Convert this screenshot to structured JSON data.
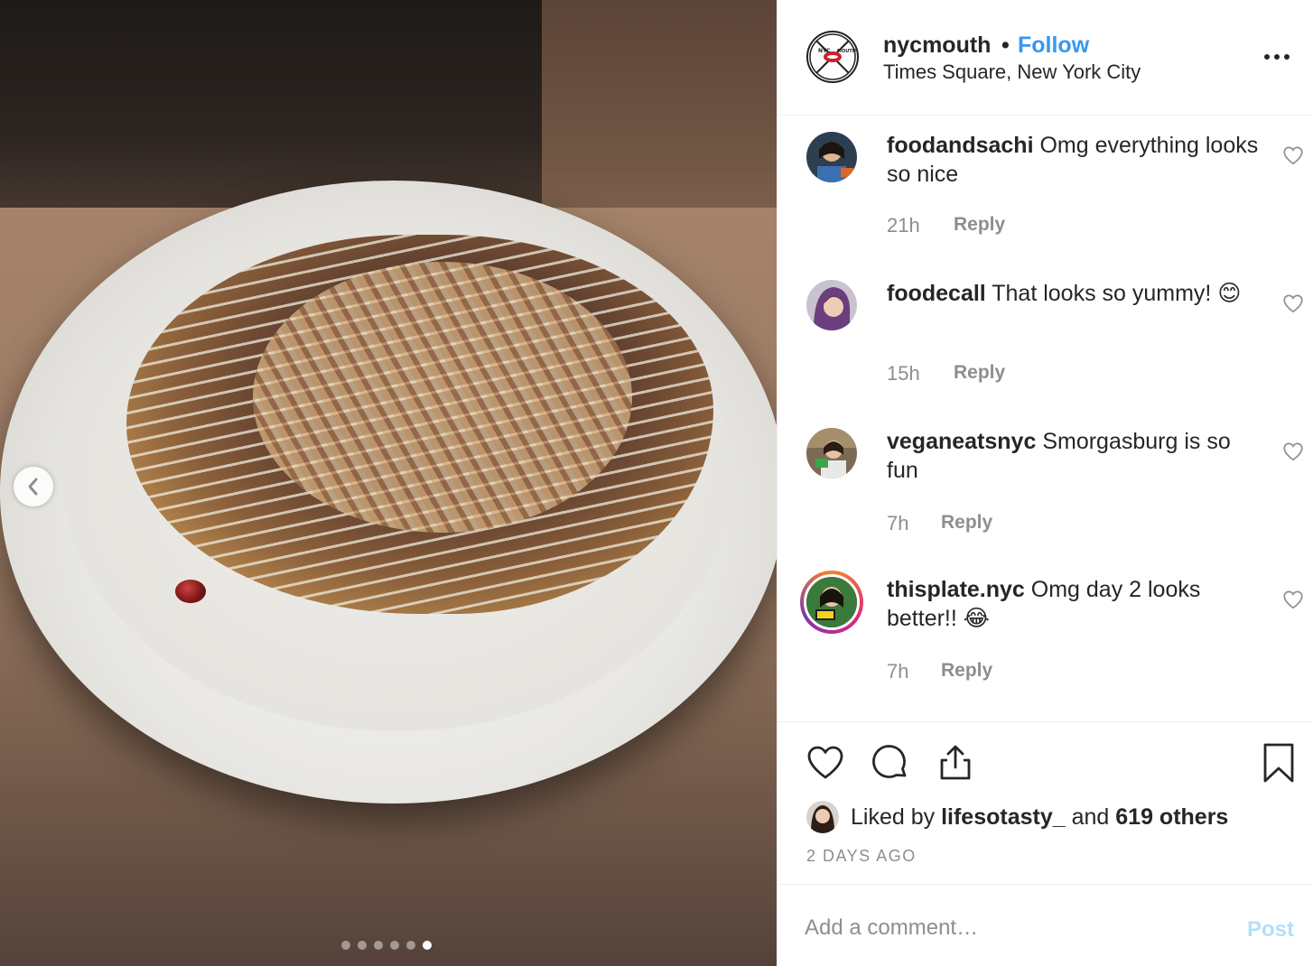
{
  "post": {
    "author": "nycmouth",
    "separator": "•",
    "follow_label": "Follow",
    "location": "Times Square, New York City",
    "logo_text": "NYC MOUTH"
  },
  "carousel": {
    "slide_count": 6,
    "active_index": 5
  },
  "comments": [
    {
      "user": "foodandsachi",
      "text": "Omg everything looks so nice",
      "time": "21h",
      "reply_label": "Reply"
    },
    {
      "user": "foodecall",
      "text": "That looks so yummy! 😊",
      "time": "15h",
      "reply_label": "Reply"
    },
    {
      "user": "veganeatsnyc",
      "text": "Smorgasburg is so fun",
      "time": "7h",
      "reply_label": "Reply"
    },
    {
      "user": "thisplate.nyc",
      "text": "Omg day 2 looks better!! 😂",
      "time": "7h",
      "reply_label": "Reply"
    }
  ],
  "likes": {
    "prefix": "Liked by",
    "user": "lifesotasty_",
    "middle": "and",
    "others": "619 others"
  },
  "timestamp": "2 DAYS AGO",
  "add_comment": {
    "placeholder": "Add a comment…",
    "post_label": "Post"
  },
  "colors": {
    "follow": "#3897f0",
    "post_disabled": "#b2dffc",
    "muted": "#8e8e8e",
    "story_ring": [
      "#f58529",
      "#dd2a7b",
      "#8134af"
    ]
  },
  "icons": {
    "prev": "chevron-left-icon",
    "more": "more-horizontal-icon",
    "like": "heart-icon",
    "comment": "comment-bubble-icon",
    "share": "share-upload-icon",
    "save": "bookmark-icon"
  }
}
